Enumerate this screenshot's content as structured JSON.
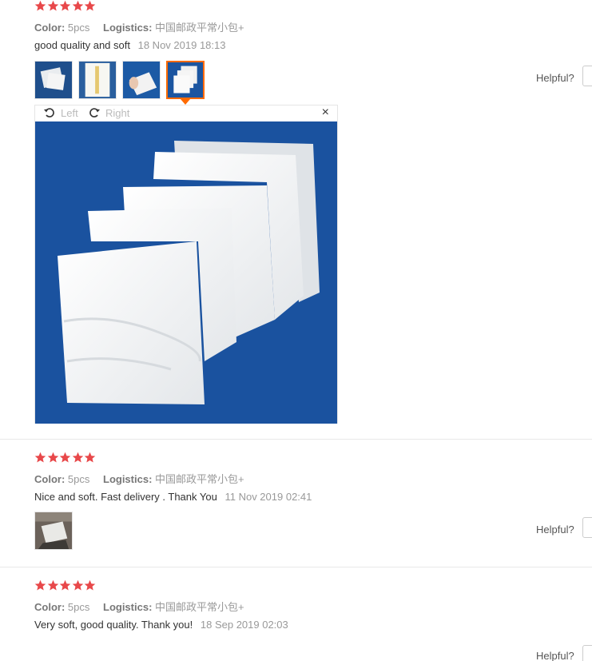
{
  "colors": {
    "star": "#e8484a",
    "accent": "#ff6a00",
    "muted": "#999999"
  },
  "labels": {
    "color_key": "Color:",
    "logistics_key": "Logistics:",
    "helpful": "Helpful?",
    "rotate_left": "Left",
    "rotate_right": "Right",
    "close": "×"
  },
  "reviews": [
    {
      "rating": 5,
      "color": "5pcs",
      "logistics": "中国邮政平常小包+",
      "text": "good quality and soft",
      "date": "18 Nov 2019 18:13",
      "thumb_icons": [
        "photo-icon",
        "photo-icon",
        "photo-icon",
        "photo-icon"
      ],
      "active_thumb": 4
    },
    {
      "rating": 5,
      "color": "5pcs",
      "logistics": "中国邮政平常小包+",
      "text": "Nice and soft. Fast delivery . Thank You",
      "date": "11 Nov 2019 02:41",
      "thumb_icons": [
        "photo-icon"
      ]
    },
    {
      "rating": 5,
      "color": "5pcs",
      "logistics": "中国邮政平常小包+",
      "text": "Very soft, good quality. Thank you!",
      "date": "18 Sep 2019 02:03",
      "thumb_icons": [
        "photo-icon"
      ]
    }
  ]
}
